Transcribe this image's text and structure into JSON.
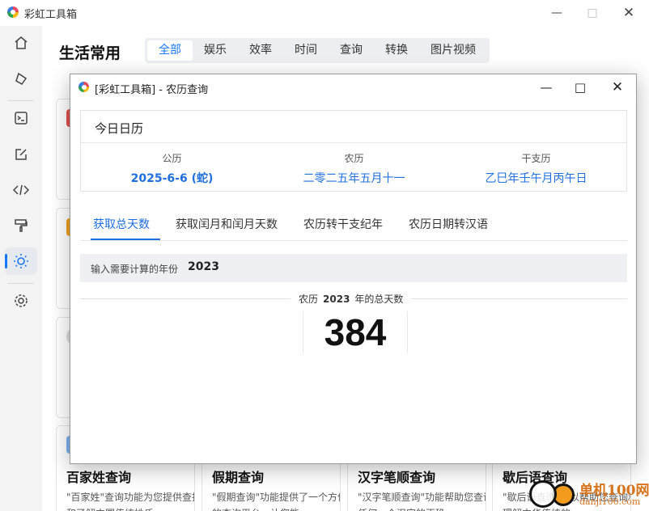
{
  "app": {
    "title": "彩虹工具箱",
    "page_title": "生活常用"
  },
  "tabs": [
    {
      "label": "全部",
      "active": true
    },
    {
      "label": "娱乐"
    },
    {
      "label": "效率"
    },
    {
      "label": "时间"
    },
    {
      "label": "查询"
    },
    {
      "label": "转换"
    },
    {
      "label": "图片视频"
    }
  ],
  "sidebar": {
    "icons": [
      "home-icon",
      "eraser-icon",
      "terminal-icon",
      "edit-icon",
      "code-icon",
      "paint-roller-icon",
      "sun-icon",
      "settings-icon"
    ],
    "active": "sun-icon"
  },
  "cards": [
    {
      "title": "百家姓查询",
      "desc": "\"百家姓\"查询功能为您提供查找和了解中国传统姓氏..."
    },
    {
      "title": "假期查询",
      "desc": "\"假期查询\"功能提供了一个方便的查询平台，让您能..."
    },
    {
      "title": "汉字笔顺查询",
      "desc": "\"汉字笔顺查询\"功能帮助您查询任何一个汉字的正确..."
    },
    {
      "title": "歇后语查询",
      "desc": "\"歇后语查询\"可以帮助您查询和理解中华传统的..."
    }
  ],
  "dialog": {
    "title": "[彩虹工具箱] - 农历查询",
    "today_label": "今日日历",
    "columns": [
      {
        "label": "公历",
        "value": "2025-6-6 (蛇)"
      },
      {
        "label": "农历",
        "value": "二零二五年五月十一"
      },
      {
        "label": "干支历",
        "value": "乙巳年壬午月丙午日"
      }
    ],
    "subtabs": [
      {
        "label": "获取总天数",
        "active": true
      },
      {
        "label": "获取闰月和闰月天数"
      },
      {
        "label": "农历转干支纪年"
      },
      {
        "label": "农历日期转汉语"
      }
    ],
    "input_label": "输入需要计算的年份",
    "input_value": "2023",
    "result_prefix": "农历",
    "result_year": "2023",
    "result_suffix": "年的总天数",
    "result_number": "384"
  },
  "watermark": {
    "text": "单机100网",
    "sub": "danji100.com"
  },
  "colors": {
    "accent": "#1677ff",
    "link": "#1f6fe0"
  }
}
